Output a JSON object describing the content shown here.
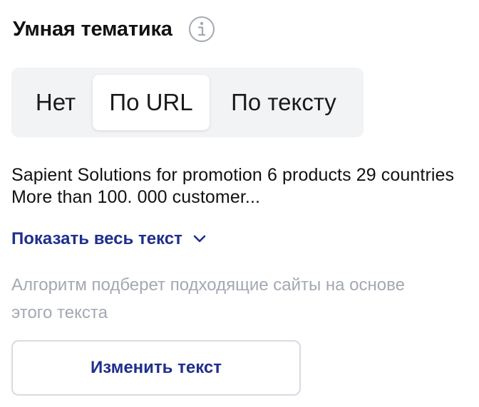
{
  "header": {
    "title": "Умная тематика",
    "info_icon": "info-icon"
  },
  "segmented": {
    "options": [
      {
        "label": "Нет",
        "selected": false
      },
      {
        "label": "По URL",
        "selected": true
      },
      {
        "label": "По тексту",
        "selected": false
      }
    ]
  },
  "snippet": {
    "text": "Sapient Solutions for promotion 6 products 29 countries More than 100. 000 customer..."
  },
  "show_all": {
    "label": "Показать весь текст",
    "icon": "chevron-down-icon"
  },
  "hint": {
    "text": "Алгоритм подберет подходящие сайты на основе этого текста"
  },
  "change_button": {
    "label": "Изменить текст"
  },
  "colors": {
    "accent": "#1f2f8c",
    "muted_text": "#a3a8b3",
    "segment_bg": "#f2f3f5",
    "border": "#d8dbe2"
  }
}
